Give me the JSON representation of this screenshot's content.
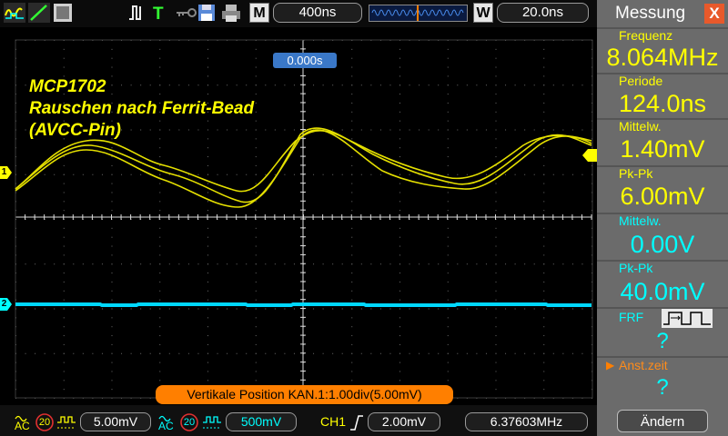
{
  "toolbar": {
    "timebase": "400ns",
    "w_label": "W",
    "m_label": "M",
    "window_value": "20.0ns",
    "trigger_icon": "trigger-T-icon"
  },
  "time_marker": "0.000s",
  "title": {
    "line1": "MCP1702",
    "line2": "Rauschen nach Ferrit-Bead",
    "line3": "(AVCC-Pin)"
  },
  "channel_markers": {
    "ch1": "1",
    "ch2": "2"
  },
  "position_banner": "Vertikale  Position  KAN.1:1.00div(5.00mV)",
  "panel": {
    "title": "Messung",
    "close": "X",
    "measurements": [
      {
        "label": "Frequenz",
        "value": "8.064MHz",
        "color": "#ffff00"
      },
      {
        "label": "Periode",
        "value": "124.0ns",
        "color": "#ffff00"
      },
      {
        "label": "Mittelw.",
        "value": "1.40mV",
        "color": "#ffff00"
      },
      {
        "label": "Pk-Pk",
        "value": "6.00mV",
        "color": "#ffff00"
      },
      {
        "label": "Mittelw.",
        "value": "0.00V",
        "color": "#00ffff"
      },
      {
        "label": "Pk-Pk",
        "value": "40.0mV",
        "color": "#00ffff"
      }
    ],
    "frf_label": "FRF",
    "frf_value": "?",
    "anst_label": "Anst.zeit",
    "anst_value": "?",
    "change_button": "Ändern"
  },
  "bottom": {
    "ch1_coupling": "AC",
    "ch1_bw": "20",
    "ch1_scale": "5.00mV",
    "ch2_coupling": "AC",
    "ch2_bw": "20",
    "ch2_scale": "500mV",
    "trigger_channel": "CH1",
    "trigger_level": "2.00mV",
    "trigger_freq": "6.37603MHz"
  },
  "colors": {
    "ch1": "#ffff00",
    "ch2": "#00ffff",
    "accent": "#ff7f00",
    "panel_bg": "#6b6b6b"
  }
}
